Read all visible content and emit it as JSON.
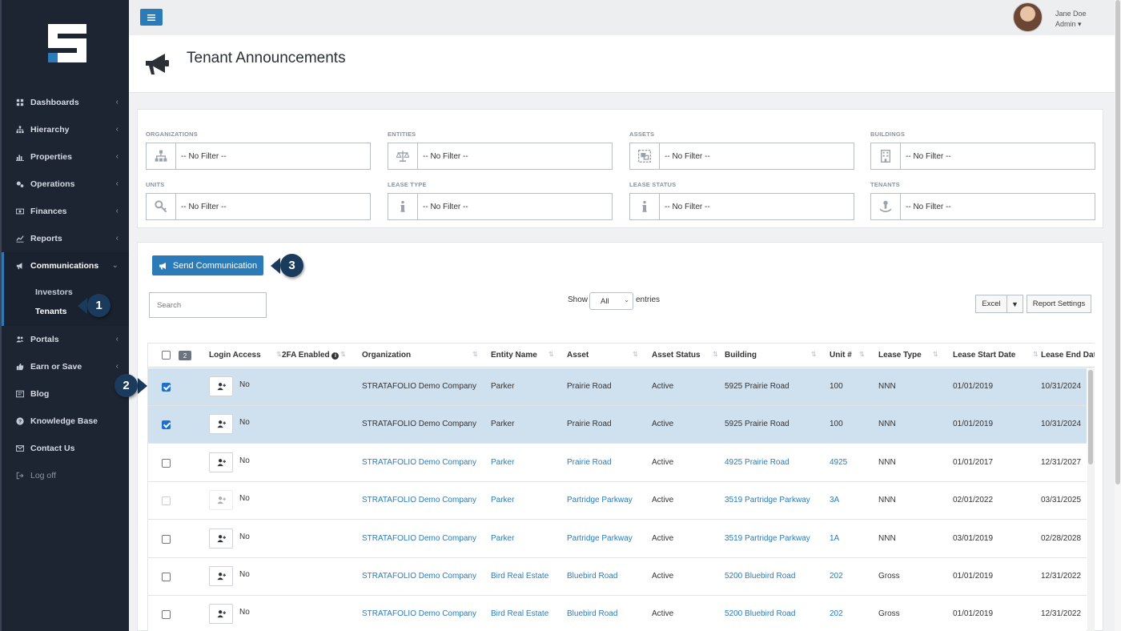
{
  "sidebar": {
    "items": [
      {
        "label": "Dashboards",
        "icon": "dashboard-icon"
      },
      {
        "label": "Hierarchy",
        "icon": "sitemap-icon"
      },
      {
        "label": "Properties",
        "icon": "bar-chart-icon"
      },
      {
        "label": "Operations",
        "icon": "gears-icon"
      },
      {
        "label": "Finances",
        "icon": "money-icon"
      },
      {
        "label": "Reports",
        "icon": "line-chart-icon"
      },
      {
        "label": "Communications",
        "icon": "bullhorn-icon"
      }
    ],
    "sub_items": [
      {
        "label": "Investors"
      },
      {
        "label": "Tenants"
      }
    ],
    "items_after": [
      {
        "label": "Portals",
        "icon": "users-icon"
      },
      {
        "label": "Earn or Save",
        "icon": "thumbs-up-icon"
      },
      {
        "label": "Blog",
        "icon": "blog-icon"
      },
      {
        "label": "Knowledge Base",
        "icon": "question-icon"
      },
      {
        "label": "Contact Us",
        "icon": "envelope-icon"
      },
      {
        "label": "Log off",
        "icon": "sign-out-icon"
      }
    ]
  },
  "user": {
    "name": "Jane Doe",
    "role": "Admin ▾"
  },
  "page": {
    "title": "Tenant Announcements"
  },
  "filters": [
    {
      "label": "ORGANIZATIONS",
      "value": "-- No Filter --",
      "icon": "sitemap-icon"
    },
    {
      "label": "ENTITIES",
      "value": "-- No Filter --",
      "icon": "balance-scale-icon"
    },
    {
      "label": "ASSETS",
      "value": "-- No Filter --",
      "icon": "object-group-icon"
    },
    {
      "label": "BUILDINGS",
      "value": "-- No Filter --",
      "icon": "building-icon"
    },
    {
      "label": "UNITS",
      "value": "-- No Filter --",
      "icon": "key-icon"
    },
    {
      "label": "LEASE TYPE",
      "value": "-- No Filter --",
      "icon": "info-icon"
    },
    {
      "label": "LEASE STATUS",
      "value": "-- No Filter --",
      "icon": "info-icon"
    },
    {
      "label": "TENANTS",
      "value": "-- No Filter --",
      "icon": "tenant-icon"
    }
  ],
  "toolbar": {
    "send_label": "Send Communication",
    "search_placeholder": "Search",
    "show_label": "Show",
    "show_value": "All",
    "entries_label": "entries",
    "excel_label": "Excel",
    "excel_dd": "▼",
    "report_settings_label": "Report Settings"
  },
  "table": {
    "selected_count": "2",
    "headers": [
      "Login Access",
      "2FA Enabled",
      "Organization",
      "Entity Name",
      "Asset",
      "Asset Status",
      "Building",
      "Unit #",
      "Lease Type",
      "Lease Start Date",
      "Lease End Dat"
    ],
    "rows": [
      {
        "selected": true,
        "disabled": false,
        "login": "No",
        "org": "STRATAFOLIO Demo Company",
        "entity": "Parker",
        "asset": "Prairie Road",
        "status": "Active",
        "building": "5925 Prairie Road",
        "unit": "100",
        "lease_type": "NNN",
        "start": "01/01/2019",
        "end": "10/31/2024"
      },
      {
        "selected": true,
        "disabled": false,
        "login": "No",
        "org": "STRATAFOLIO Demo Company",
        "entity": "Parker",
        "asset": "Prairie Road",
        "status": "Active",
        "building": "5925 Prairie Road",
        "unit": "100",
        "lease_type": "NNN",
        "start": "01/01/2019",
        "end": "10/31/2024"
      },
      {
        "selected": false,
        "disabled": false,
        "login": "No",
        "org": "STRATAFOLIO Demo Company",
        "entity": "Parker",
        "asset": "Prairie Road",
        "status": "Active",
        "building": "4925 Prairie Road",
        "unit": "4925",
        "lease_type": "NNN",
        "start": "01/01/2017",
        "end": "12/31/2027"
      },
      {
        "selected": false,
        "disabled": true,
        "login": "No",
        "org": "STRATAFOLIO Demo Company",
        "entity": "Parker",
        "asset": "Partridge Parkway",
        "status": "Active",
        "building": "3519 Partridge Parkway",
        "unit": "3A",
        "lease_type": "NNN",
        "start": "02/01/2022",
        "end": "03/31/2025"
      },
      {
        "selected": false,
        "disabled": false,
        "login": "No",
        "org": "STRATAFOLIO Demo Company",
        "entity": "Parker",
        "asset": "Partridge Parkway",
        "status": "Active",
        "building": "3519 Partridge Parkway",
        "unit": "1A",
        "lease_type": "NNN",
        "start": "03/01/2019",
        "end": "02/28/2028"
      },
      {
        "selected": false,
        "disabled": false,
        "login": "No",
        "org": "STRATAFOLIO Demo Company",
        "entity": "Bird Real Estate",
        "asset": "Bluebird Road",
        "status": "Active",
        "building": "5200 Bluebird Road",
        "unit": "202",
        "lease_type": "Gross",
        "start": "01/01/2019",
        "end": "12/31/2022"
      },
      {
        "selected": false,
        "disabled": false,
        "login": "No",
        "org": "STRATAFOLIO Demo Company",
        "entity": "Bird Real Estate",
        "asset": "Bluebird Road",
        "status": "Active",
        "building": "5200 Bluebird Road",
        "unit": "202",
        "lease_type": "Gross",
        "start": "01/01/2019",
        "end": "12/31/2022"
      }
    ]
  },
  "callouts": [
    "1",
    "2",
    "3"
  ],
  "colors": {
    "accent": "#2b7bb9",
    "sidebar": "#1d2533",
    "selected_row": "#cfe0ee",
    "callout": "#1a3b5c"
  }
}
